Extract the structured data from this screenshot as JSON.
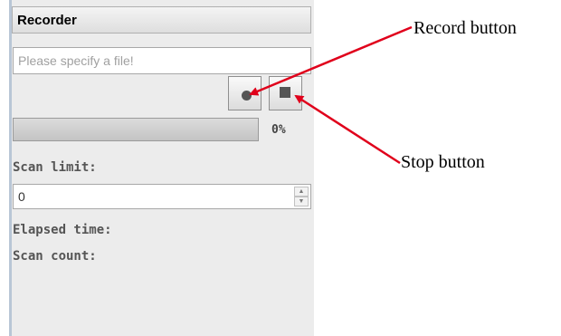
{
  "recorder": {
    "title": "Recorder",
    "file_placeholder": "Please specify a file!",
    "progress": {
      "percent_label": "0%",
      "fraction": 0
    },
    "scan_limit": {
      "label": "Scan limit:",
      "value": "0"
    },
    "elapsed_time_label": "Elapsed time:",
    "scan_count_label": "Scan count:",
    "icons": {
      "record": "record-dot-icon",
      "stop": "stop-square-icon",
      "spin_up": "spin-up-arrow-icon",
      "spin_down": "spin-down-arrow-icon"
    }
  },
  "annotations": {
    "record_button": "Record button",
    "stop_button": "Stop button",
    "arrow_color": "#e0001b"
  }
}
